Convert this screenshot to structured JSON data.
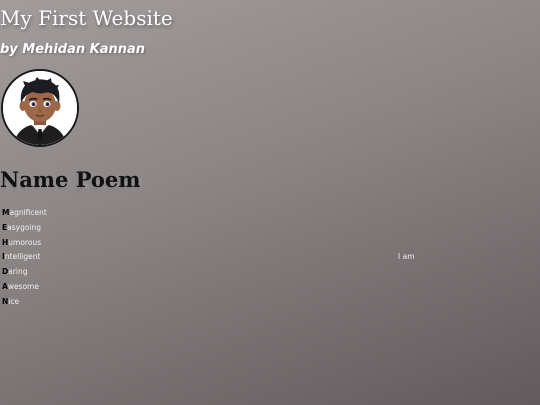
{
  "site": {
    "title": "My First Website",
    "byline": "by Mehidan Kannan"
  },
  "avatar": {
    "icon": "boy-avatar-icon",
    "colors": {
      "ring": "#1a1a1a",
      "hair": "#1c1c22",
      "skin": "#9c6848",
      "suit": "#1e1e1e",
      "tie": "#111111"
    }
  },
  "section": {
    "heading": "Name Poem"
  },
  "poem": {
    "lines": [
      {
        "letter": "M",
        "rest": "agnificent",
        "note": ""
      },
      {
        "letter": "E",
        "rest": "asygoing",
        "note": ""
      },
      {
        "letter": "H",
        "rest": "umorous",
        "note": ""
      },
      {
        "letter": "I",
        "rest": "ntelligent",
        "note": "I am"
      },
      {
        "letter": "D",
        "rest": "aring",
        "note": ""
      },
      {
        "letter": "A",
        "rest": "wesome",
        "note": ""
      },
      {
        "letter": "N",
        "rest": "ice",
        "note": ""
      }
    ]
  },
  "colors": {
    "background_top": "#a29c9c",
    "background_bottom": "#625a5c",
    "title_text": "#ffffff",
    "heading_text": "#111111"
  }
}
